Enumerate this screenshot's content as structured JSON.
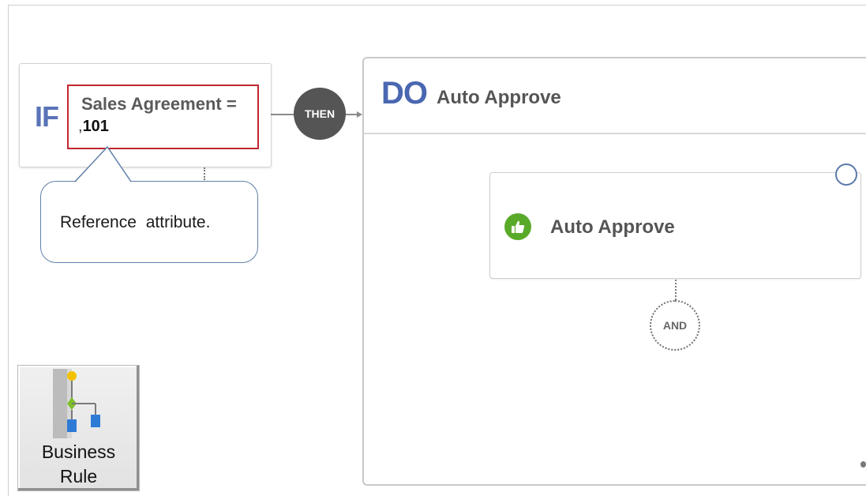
{
  "if_block": {
    "label": "IF",
    "condition_line1": "Sales Agreement =",
    "condition_prefix": ",",
    "condition_value": "101"
  },
  "connector": {
    "label": "THEN"
  },
  "callout": {
    "text": "Reference attribute."
  },
  "do_block": {
    "label": "DO",
    "title": "Auto Approve",
    "action": {
      "title": "Auto Approve",
      "icon": "thumbs-up-icon",
      "icon_color": "#5aaa2a"
    },
    "and_node": "AND"
  },
  "toolbar": {
    "business_rule": {
      "line1": "Business",
      "line2": "Rule",
      "icon": "flowchart-icon"
    }
  },
  "colors": {
    "highlight": "#c0262d",
    "keyword_blue": "#5a73b8",
    "then_node": "#555555",
    "callout_border": "#5f7fa8"
  }
}
